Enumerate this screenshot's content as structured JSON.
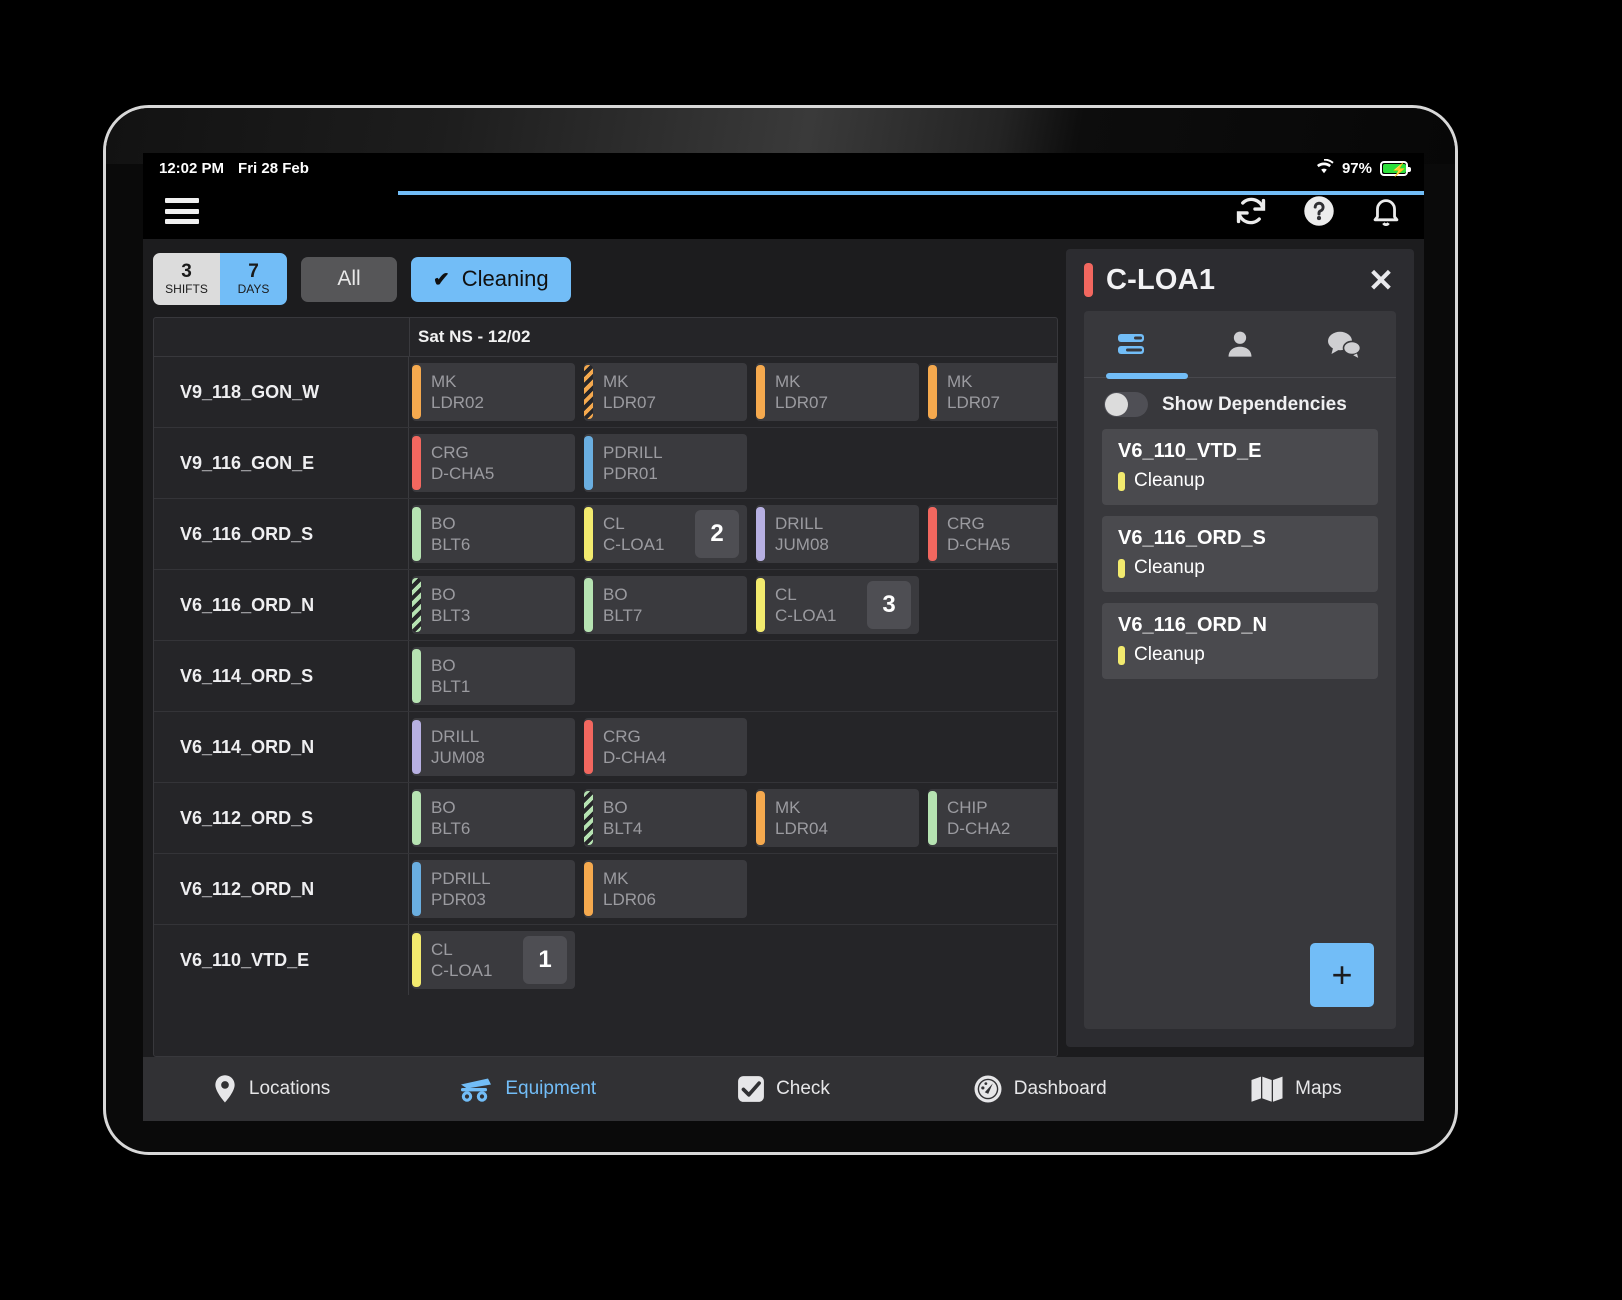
{
  "status_bar": {
    "time": "12:02 PM",
    "date": "Fri 28 Feb",
    "battery": "97%"
  },
  "toolbar": {
    "menu_icon": "hamburger-icon",
    "refresh_icon": "refresh-icon",
    "help_icon": "help-icon",
    "notifications_icon": "bell-icon"
  },
  "filters": {
    "segment": [
      {
        "value": "3",
        "unit": "SHIFTS",
        "active": false
      },
      {
        "value": "7",
        "unit": "DAYS",
        "active": true
      }
    ],
    "all_label": "All",
    "cleaning_label": "Cleaning",
    "cleaning_check": "✔"
  },
  "schedule": {
    "day_header": "Sat NS - 12/02",
    "rows": [
      {
        "label": "V9_118_GON_W",
        "cards": [
          {
            "code": "MK",
            "unit": "LDR02",
            "color": "#f5a94e",
            "striped": false,
            "badge": null
          },
          {
            "code": "MK",
            "unit": "LDR07",
            "color": "#f5a94e",
            "striped": true,
            "badge": null
          },
          {
            "code": "MK",
            "unit": "LDR07",
            "color": "#f5a94e",
            "striped": false,
            "badge": null
          },
          {
            "code": "MK",
            "unit": "LDR07",
            "color": "#f5a94e",
            "striped": false,
            "badge": null
          }
        ]
      },
      {
        "label": "V9_116_GON_E",
        "cards": [
          {
            "code": "CRG",
            "unit": "D-CHA5",
            "color": "#f2675f",
            "striped": false,
            "badge": null
          },
          {
            "code": "PDRILL",
            "unit": "PDR01",
            "color": "#6aaee0",
            "striped": false,
            "badge": null
          }
        ]
      },
      {
        "label": "V6_116_ORD_S",
        "cards": [
          {
            "code": "BO",
            "unit": "BLT6",
            "color": "#b6e3b2",
            "striped": false,
            "badge": null
          },
          {
            "code": "CL",
            "unit": "C-LOA1",
            "color": "#f2ea6e",
            "striped": false,
            "badge": "2"
          },
          {
            "code": "DRILL",
            "unit": "JUM08",
            "color": "#b7b0e2",
            "striped": false,
            "badge": null
          },
          {
            "code": "CRG",
            "unit": "D-CHA5",
            "color": "#f2675f",
            "striped": false,
            "badge": null
          }
        ]
      },
      {
        "label": "V6_116_ORD_N",
        "cards": [
          {
            "code": "BO",
            "unit": "BLT3",
            "color": "#b6e3b2",
            "striped": true,
            "badge": null
          },
          {
            "code": "BO",
            "unit": "BLT7",
            "color": "#b6e3b2",
            "striped": false,
            "badge": null
          },
          {
            "code": "CL",
            "unit": "C-LOA1",
            "color": "#f2ea6e",
            "striped": false,
            "badge": "3"
          }
        ]
      },
      {
        "label": "V6_114_ORD_S",
        "cards": [
          {
            "code": "BO",
            "unit": "BLT1",
            "color": "#b6e3b2",
            "striped": false,
            "badge": null
          }
        ]
      },
      {
        "label": "V6_114_ORD_N",
        "cards": [
          {
            "code": "DRILL",
            "unit": "JUM08",
            "color": "#b7b0e2",
            "striped": false,
            "badge": null
          },
          {
            "code": "CRG",
            "unit": "D-CHA4",
            "color": "#f2675f",
            "striped": false,
            "badge": null
          }
        ]
      },
      {
        "label": "V6_112_ORD_S",
        "cards": [
          {
            "code": "BO",
            "unit": "BLT6",
            "color": "#b6e3b2",
            "striped": false,
            "badge": null
          },
          {
            "code": "BO",
            "unit": "BLT4",
            "color": "#b6e3b2",
            "striped": true,
            "badge": null
          },
          {
            "code": "MK",
            "unit": "LDR04",
            "color": "#f5a94e",
            "striped": false,
            "badge": null
          },
          {
            "code": "CHIP",
            "unit": "D-CHA2",
            "color": "#b6e3b2",
            "striped": false,
            "badge": null
          }
        ]
      },
      {
        "label": "V6_112_ORD_N",
        "cards": [
          {
            "code": "PDRILL",
            "unit": "PDR03",
            "color": "#6aaee0",
            "striped": false,
            "badge": null
          },
          {
            "code": "MK",
            "unit": "LDR06",
            "color": "#f5a94e",
            "striped": false,
            "badge": null
          }
        ]
      },
      {
        "label": "V6_110_VTD_E",
        "cards": [
          {
            "code": "CL",
            "unit": "C-LOA1",
            "color": "#f2ea6e",
            "striped": false,
            "badge": "1"
          }
        ]
      }
    ]
  },
  "panel": {
    "title": "C-LOA1",
    "accent_color": "#f2675f",
    "close_icon": "close-icon",
    "tabs": [
      {
        "icon": "task-list-icon",
        "active": true
      },
      {
        "icon": "person-icon",
        "active": false
      },
      {
        "icon": "chat-icon",
        "active": false
      }
    ],
    "toggle_label": "Show Dependencies",
    "toggle_on": false,
    "dependencies": [
      {
        "location": "V6_110_VTD_E",
        "task": "Cleanup",
        "color": "#f2ea6e"
      },
      {
        "location": "V6_116_ORD_S",
        "task": "Cleanup",
        "color": "#f2ea6e"
      },
      {
        "location": "V6_116_ORD_N",
        "task": "Cleanup",
        "color": "#f2ea6e"
      }
    ],
    "add_label": "+"
  },
  "bottom_nav": [
    {
      "label": "Locations",
      "icon": "location-pin-icon",
      "active": false
    },
    {
      "label": "Equipment",
      "icon": "equipment-truck-icon",
      "active": true
    },
    {
      "label": "Check",
      "icon": "checkbox-icon",
      "active": false
    },
    {
      "label": "Dashboard",
      "icon": "gauge-icon",
      "active": false
    },
    {
      "label": "Maps",
      "icon": "map-icon",
      "active": false
    }
  ]
}
